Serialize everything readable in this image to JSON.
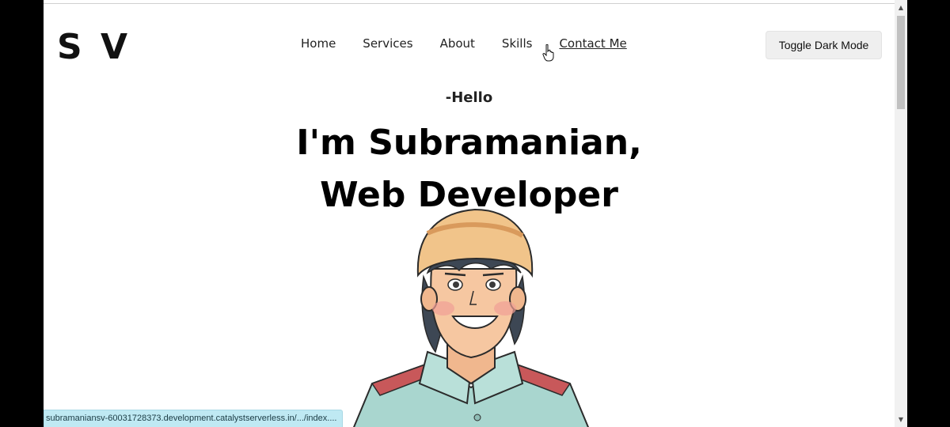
{
  "logo": "S V",
  "nav": {
    "items": [
      "Home",
      "Services",
      "About",
      "Skills",
      "Contact Me"
    ]
  },
  "toggle_button": "Toggle Dark Mode",
  "hero": {
    "greeting": "-Hello",
    "headline_line1": "I'm Subramanian,",
    "headline_line2": "Web Developer"
  },
  "status_bar": {
    "url": "subramaniansv-60031728373.development.catalystserverless.in/.../index...."
  },
  "colors": {
    "page_bg": "#ffffff",
    "frame_bg": "#000000",
    "toggle_bg": "#efefef",
    "status_bg": "#bfe9f3"
  }
}
